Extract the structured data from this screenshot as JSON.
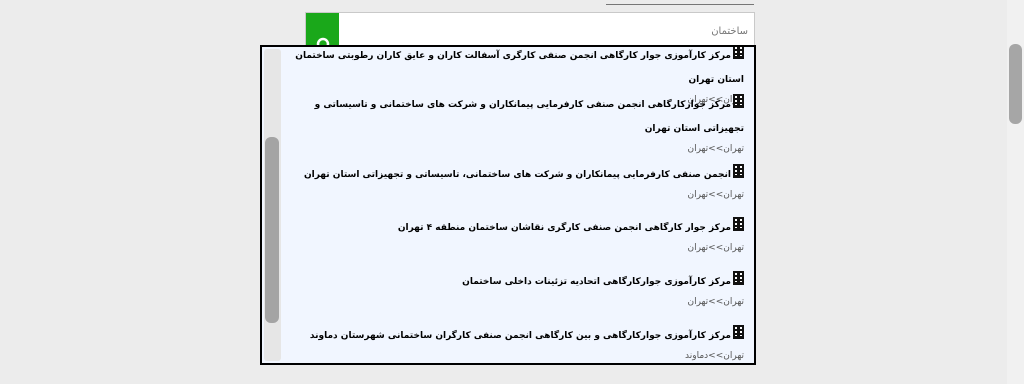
{
  "search": {
    "placeholder": "ساختمان"
  },
  "results": [
    {
      "title": "مرکز کارآموزی جوار کارگاهی انجمن صنفی کارگری آسفالت کاران و عایق کاران رطوبتی ساختمان استان تهران",
      "location": "تهران>>تهران"
    },
    {
      "title": "مرکز جوارکارگاهی انجمن صنفی کارفرمایی پیمانکاران و شرکت های ساختمانی و تاسیساتی و تجهیزاتی استان تهران",
      "location": "تهران>>تهران"
    },
    {
      "title": "انجمن صنفی کارفرمایی پیمانکاران و شرکت های ساختمانی، تاسیساتی و تجهیزاتی استان تهران",
      "location": "تهران>>تهران"
    },
    {
      "title": "مرکز جوار کارگاهی انجمن صنفی کارگری نقاشان ساختمان منطقه ۴ تهران",
      "location": "تهران>>تهران"
    },
    {
      "title": "مرکز کارآموزی جوارکارگاهی اتحادیه تزئینات داخلی ساختمان",
      "location": "تهران>>تهران"
    },
    {
      "title": "مرکز کارآموزی جوارکارگاهی و بین کارگاهی انجمن صنفی کارگران ساختمانی شهرستان دماوند",
      "location": "تهران>>دماوند"
    }
  ],
  "icons": {
    "search": "search-icon",
    "result": "building-icon"
  },
  "colors": {
    "search_button": "#1aa81a",
    "results_background": "#f1f6ff"
  }
}
